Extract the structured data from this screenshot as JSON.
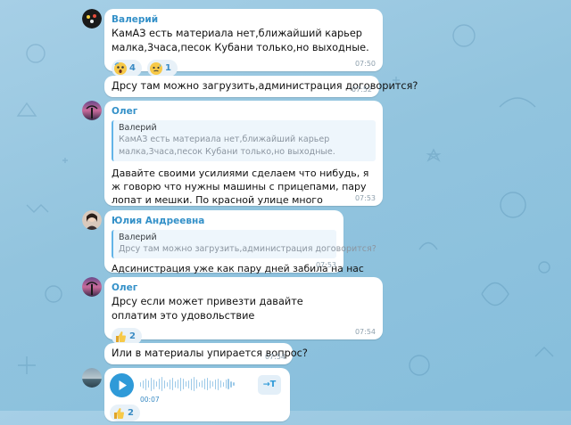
{
  "messages": [
    {
      "sender": "Валерий",
      "sender_color": "#3390c8",
      "text": "КамАЗ есть материала нет,ближайший карьер малка,3часа,песок Кубани только,но выходные.",
      "time": "07:50",
      "reactions": [
        {
          "icon": "screaming-face-emoji",
          "count": "4"
        },
        {
          "icon": "sweat-face-emoji",
          "count": "1"
        }
      ]
    },
    {
      "text": "Дрсу там можно загрузить,администрация договорится?",
      "time": "07:52"
    },
    {
      "sender": "Олег",
      "sender_color": "#3390c8",
      "reply": {
        "author": "Валерий",
        "text": "КамАЗ есть материала нет,ближайший карьер малка,3часа,песок Кубани только,но выходные."
      },
      "text": "Давайте своими усилиями сделаем что нибудь, я ж говорю что нужны машины с прицепами, пару лопат и мешки. По красной улице много строительных отходов и на наших улицах покататься",
      "time": "07:53"
    },
    {
      "sender": "Юлия Андреевна",
      "sender_color": "#3390c8",
      "reply": {
        "author": "Валерий",
        "text": "Дрсу там можно загрузить,администрация договорится?"
      },
      "text": "Адсинистрация уже как пару дней забила на нас",
      "time": "07:53"
    },
    {
      "sender": "Олег",
      "sender_color": "#3390c8",
      "text": "Дрсу если может привезти давайте оплатим это удовольствие",
      "time": "07:54",
      "reactions": [
        {
          "icon": "thumbs-up-emoji",
          "count": "2"
        }
      ]
    },
    {
      "text": "Или в материалы упирается вопрос?",
      "time": "07:54"
    },
    {
      "voice": {
        "duration": "00:07",
        "transcribe_label": "→T"
      },
      "reactions": [
        {
          "icon": "thumbs-up-emoji",
          "count": "2"
        }
      ]
    }
  ],
  "colors": {
    "accent": "#2f9ad8",
    "bubble": "#ffffff",
    "time": "#8ea0ad",
    "reply_bar": "#63b4e8"
  }
}
